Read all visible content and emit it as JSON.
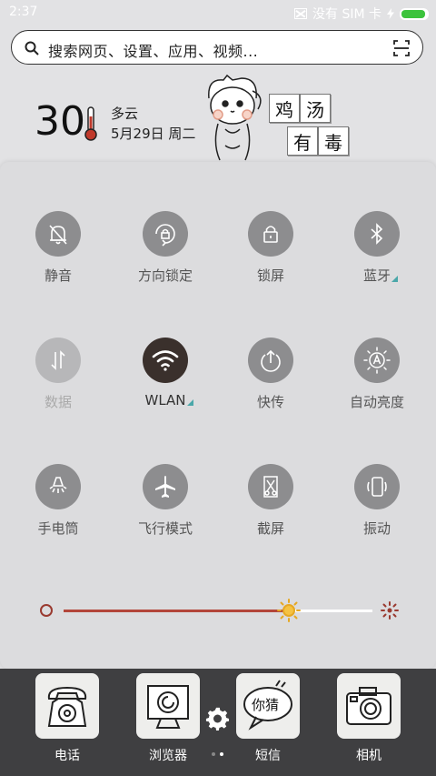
{
  "status_bar": {
    "time": "2:37",
    "carrier": "没有 SIM 卡",
    "battery_level": 0.95,
    "battery_color": "#3cc33c"
  },
  "search": {
    "placeholder": "搜索网页、设置、应用、视频..."
  },
  "weather": {
    "temperature": "30",
    "condition": "多云",
    "date": "5月29日 周二",
    "sign_chars": [
      "鸡",
      "汤",
      "有",
      "毒"
    ]
  },
  "toggles": [
    {
      "label": "静音",
      "icon": "bell-off-icon",
      "state": "off"
    },
    {
      "label": "方向锁定",
      "icon": "rotation-lock-icon",
      "state": "off"
    },
    {
      "label": "锁屏",
      "icon": "lock-icon",
      "state": "off"
    },
    {
      "label": "蓝牙",
      "icon": "bluetooth-icon",
      "state": "off"
    },
    {
      "label": "数据",
      "icon": "mobile-data-icon",
      "state": "disabled"
    },
    {
      "label": "WLAN",
      "icon": "wifi-icon",
      "state": "on"
    },
    {
      "label": "快传",
      "icon": "quick-transfer-icon",
      "state": "off"
    },
    {
      "label": "自动亮度",
      "icon": "auto-brightness-icon",
      "state": "off"
    },
    {
      "label": "手电筒",
      "icon": "flashlight-icon",
      "state": "off"
    },
    {
      "label": "飞行模式",
      "icon": "airplane-icon",
      "state": "off"
    },
    {
      "label": "截屏",
      "icon": "screenshot-icon",
      "state": "off"
    },
    {
      "label": "振动",
      "icon": "vibrate-icon",
      "state": "off"
    }
  ],
  "brightness": {
    "level": 0.73,
    "track_color": "#b3463a"
  },
  "dock": {
    "apps": [
      {
        "name": "电话",
        "icon": "telephone-icon"
      },
      {
        "name": "浏览器",
        "icon": "browser-icon"
      },
      {
        "name": "短信",
        "icon": "message-bubble-icon",
        "bubble_text": "你猜"
      },
      {
        "name": "相机",
        "icon": "camera-icon"
      }
    ],
    "page_count": 2,
    "current_page": 2
  }
}
